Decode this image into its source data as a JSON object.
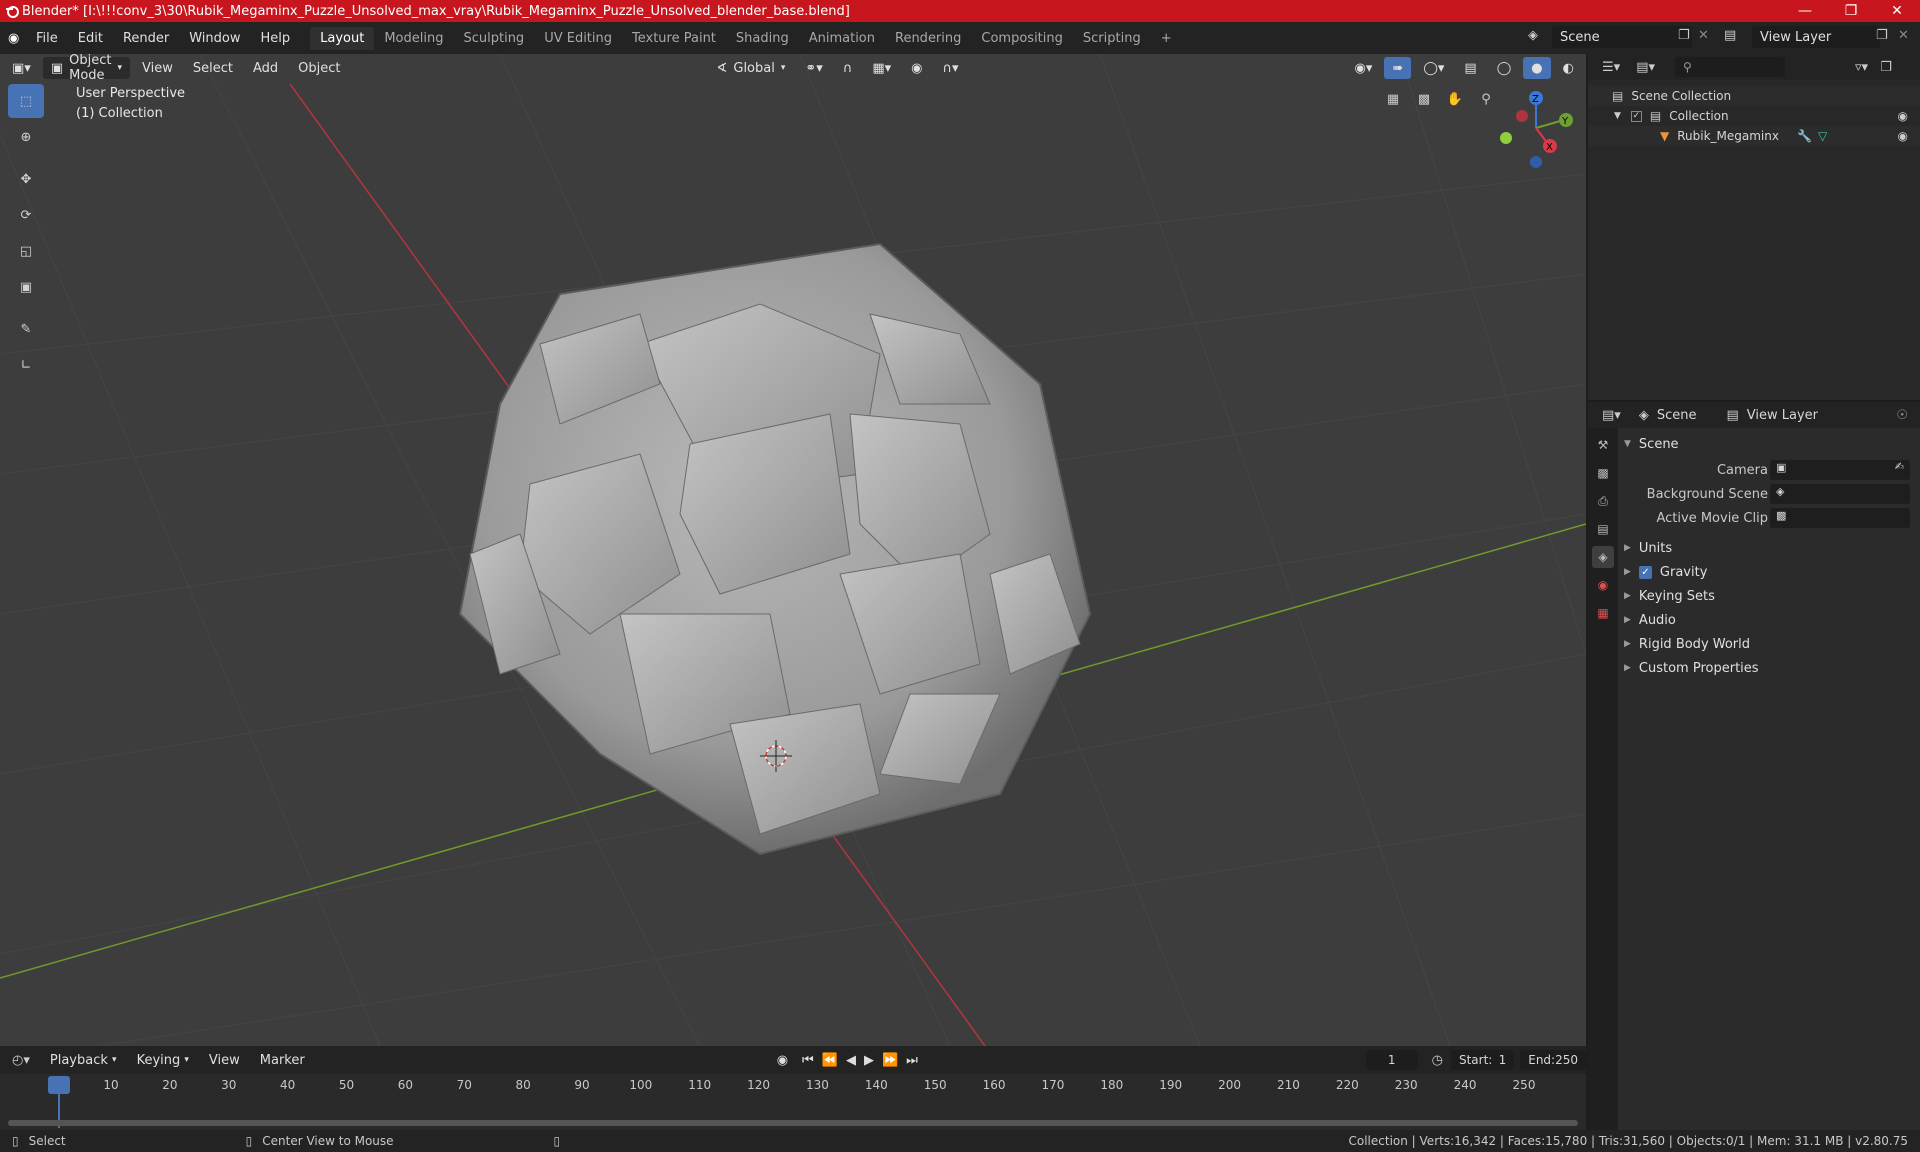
{
  "window": {
    "title": "Blender* [I:\\!!!conv_3\\30\\Rubik_Megaminx_Puzzle_Unsolved_max_vray\\Rubik_Megaminx_Puzzle_Unsolved_blender_base.blend]"
  },
  "menu": [
    "File",
    "Edit",
    "Render",
    "Window",
    "Help"
  ],
  "workspaces": [
    "Layout",
    "Modeling",
    "Sculpting",
    "UV Editing",
    "Texture Paint",
    "Shading",
    "Animation",
    "Rendering",
    "Compositing",
    "Scripting"
  ],
  "active_workspace": "Layout",
  "scene_name": "Scene",
  "view_layer_name": "View Layer",
  "viewport": {
    "mode": "Object Mode",
    "menus": [
      "View",
      "Select",
      "Add",
      "Object"
    ],
    "transform": "Global",
    "perspective": "User Perspective",
    "collection": "(1) Collection",
    "axes": {
      "x": "X",
      "y": "Y",
      "z": "Z"
    }
  },
  "outliner": {
    "root": "Scene Collection",
    "collection": "Collection",
    "object": "Rubik_Megaminx"
  },
  "properties": {
    "tab_scene": "Scene",
    "tab_view_layer": "View Layer",
    "panel": "Scene",
    "camera_label": "Camera",
    "bg_scene_label": "Background Scene",
    "movie_clip_label": "Active Movie Clip",
    "sections": [
      "Units",
      "Gravity",
      "Keying Sets",
      "Audio",
      "Rigid Body World",
      "Custom Properties"
    ]
  },
  "timeline": {
    "menus": [
      "Playback",
      "Keying",
      "View",
      "Marker"
    ],
    "current_frame": "1",
    "start_label": "Start:",
    "start": "1",
    "end_label": "End:",
    "end": "250",
    "ruler": [
      "1",
      "10",
      "20",
      "30",
      "40",
      "50",
      "60",
      "70",
      "80",
      "90",
      "100",
      "110",
      "120",
      "130",
      "140",
      "150",
      "160",
      "170",
      "180",
      "190",
      "200",
      "210",
      "220",
      "230",
      "240",
      "250"
    ]
  },
  "status": {
    "left1": "Select",
    "left2": "Center View to Mouse",
    "right": "Collection | Verts:16,342 | Faces:15,780 | Tris:31,560 | Objects:0/1 | Mem: 31.1 MB | v2.80.75"
  }
}
